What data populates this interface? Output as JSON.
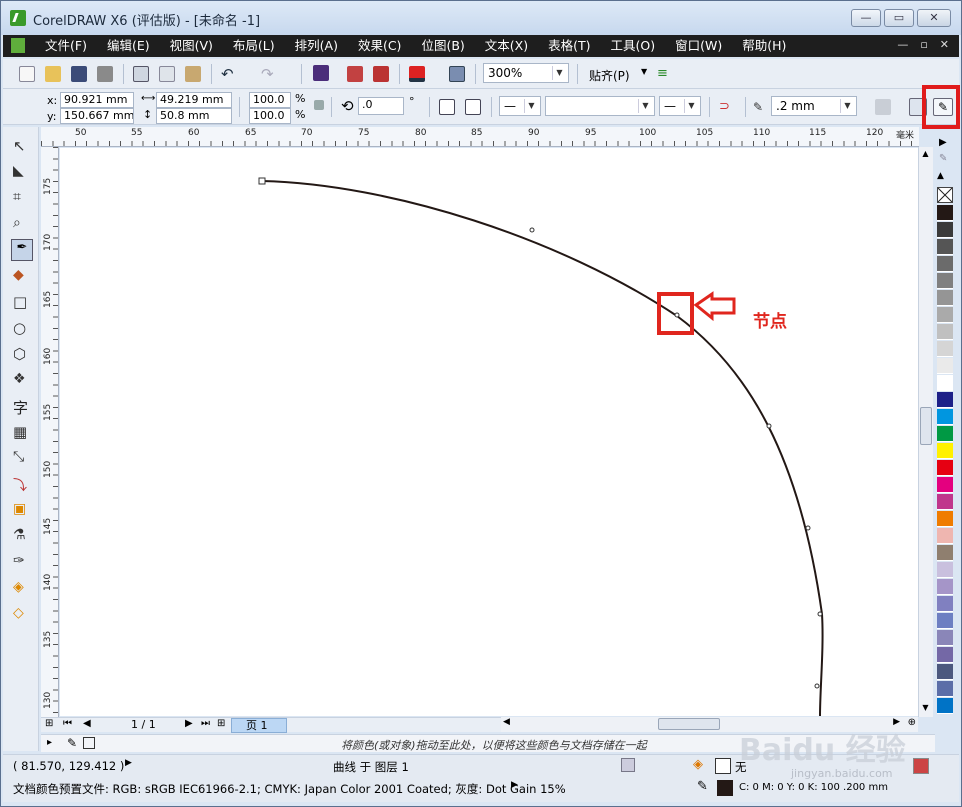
{
  "window": {
    "title": "CorelDRAW X6 (评估版) - [未命名 -1]",
    "controls": [
      "—",
      "▭",
      "✕"
    ]
  },
  "menu": {
    "items": [
      "文件(F)",
      "编辑(E)",
      "视图(V)",
      "布局(L)",
      "排列(A)",
      "效果(C)",
      "位图(B)",
      "文本(X)",
      "表格(T)",
      "工具(O)",
      "窗口(W)",
      "帮助(H)"
    ],
    "doc_controls": [
      "—",
      "▫",
      "✕"
    ]
  },
  "toolbar": {
    "zoom_value": "300%",
    "snap_label": "贴齐(P)"
  },
  "property_bar": {
    "x_label": "x:",
    "x_value": "90.921 mm",
    "y_label": "y:",
    "y_value": "150.667 mm",
    "width_value": "49.219 mm",
    "height_value": "50.8 mm",
    "scale_x": "100.0",
    "scale_y": "100.0",
    "percent": "%",
    "rotation": ".0",
    "degree": "°",
    "outline_width": ".2 mm"
  },
  "rulers": {
    "horizontal": [
      "50",
      "55",
      "60",
      "65",
      "70",
      "75",
      "80",
      "85",
      "90",
      "95",
      "100",
      "105",
      "110",
      "115",
      "120"
    ],
    "horizontal_unit": "毫米",
    "vertical": [
      "175",
      "170",
      "165",
      "160",
      "155",
      "150",
      "145",
      "140",
      "135",
      "130"
    ]
  },
  "annotation": {
    "label": "节点",
    "color": "#e0261e"
  },
  "page_nav": {
    "page_count": "1 / 1",
    "tab_label": "页 1"
  },
  "docker_hint": "将颜色(或对象)拖动至此处，以便将这些颜色与文档存储在一起",
  "status": {
    "coords": "( 81.570, 129.412 )",
    "selection": "曲线 于 图层 1",
    "fill_label": "无",
    "profile": "文档颜色预置文件: RGB: sRGB IEC61966-2.1; CMYK: Japan Color 2001 Coated; 灰度: Dot Gain 15%",
    "outline_info": "C: 0 M: 0 Y: 0 K: 100  .200 mm"
  },
  "watermark": {
    "brand": "Baidu 经验",
    "url": "jingyan.baidu.com"
  },
  "palette": [
    "#231815",
    "#3a3a3a",
    "#555555",
    "#6b6b6b",
    "#808080",
    "#959595",
    "#aaaaaa",
    "#c0c0c0",
    "#d5d5d5",
    "#eaeaea",
    "#ffffff",
    "#1d2088",
    "#0096e0",
    "#009944",
    "#fff100",
    "#e60012",
    "#e4007f",
    "#c0368c",
    "#ef7c00",
    "#efb6b0",
    "#8f7f6f",
    "#c9c0de",
    "#a595c8",
    "#8080c0",
    "#6d7fc2",
    "#8a86b8",
    "#7468a6",
    "#4c587e",
    "#5b6ea8",
    "#0073c6"
  ]
}
